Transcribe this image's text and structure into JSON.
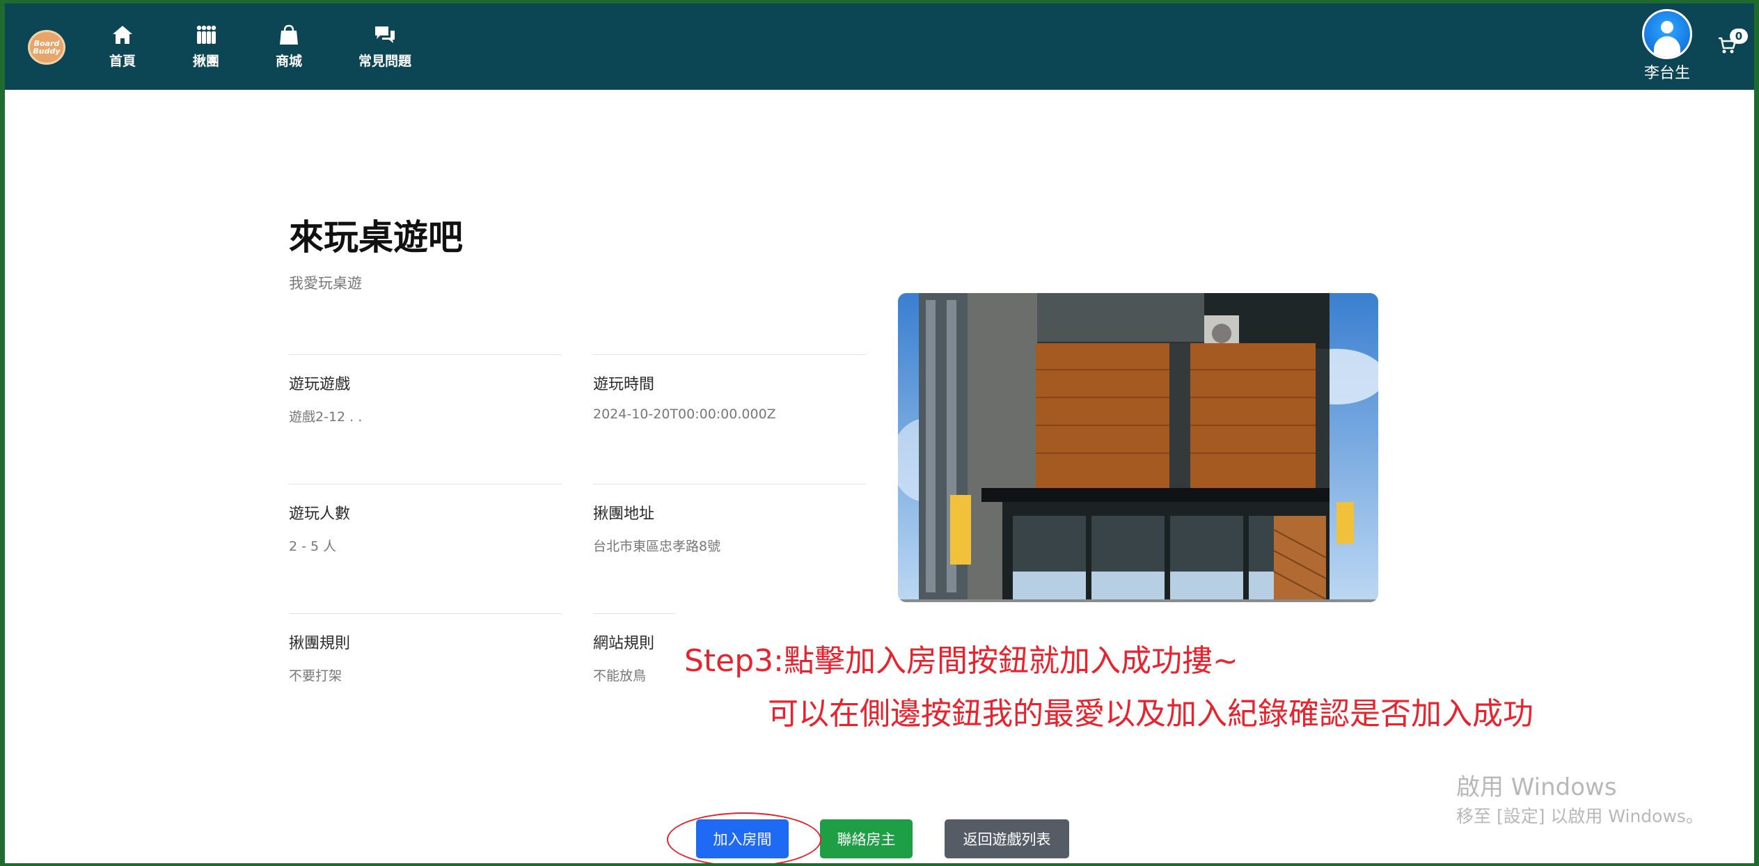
{
  "nav": {
    "logo_text": "Board Buddy",
    "items": [
      {
        "label": "首頁",
        "icon": "home-icon"
      },
      {
        "label": "揪團",
        "icon": "group-icon"
      },
      {
        "label": "商城",
        "icon": "shopping-bag-icon"
      },
      {
        "label": "常見問題",
        "icon": "chat-icon"
      }
    ],
    "user_name": "李台生",
    "cart_count": "0"
  },
  "room": {
    "title": "來玩桌遊吧",
    "subtitle": "我愛玩桌遊",
    "fields": [
      {
        "label": "遊玩遊戲",
        "value": "遊戲2-12 . ."
      },
      {
        "label": "遊玩時間",
        "value": "2024-10-20T00:00:00.000Z"
      },
      {
        "label": "遊玩人數",
        "value": "2 - 5 人"
      },
      {
        "label": "揪團地址",
        "value": "台北市東區忠孝路8號"
      },
      {
        "label": "揪團規則",
        "value": "不要打架"
      },
      {
        "label": "網站規則",
        "value": "不能放鳥"
      }
    ]
  },
  "buttons": {
    "join": "加入房間",
    "contact": "聯絡房主",
    "back": "返回遊戲列表"
  },
  "annotation": {
    "line1": "Step3:點擊加入房間按鈕就加入成功摟~",
    "line2": "可以在側邊按鈕我的最愛以及加入紀錄確認是否加入成功"
  },
  "watermark": {
    "line1": "啟用 Windows",
    "line2": "移至 [設定] 以啟用 Windows。"
  },
  "colors": {
    "navbar": "#0c4654",
    "join_button": "#1e6af5",
    "contact_button": "#1e9e45",
    "back_button": "#555c66",
    "annotation": "#e8232d"
  }
}
